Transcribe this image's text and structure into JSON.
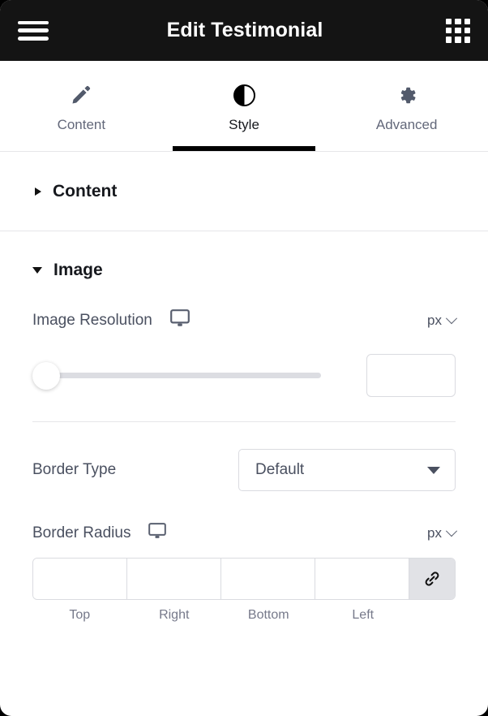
{
  "header": {
    "title": "Edit Testimonial",
    "menu_icon": "hamburger-menu-icon",
    "apps_icon": "grid-apps-icon"
  },
  "tabs": [
    {
      "label": "Content",
      "icon": "pencil-icon",
      "active": false
    },
    {
      "label": "Style",
      "icon": "contrast-icon",
      "active": true
    },
    {
      "label": "Advanced",
      "icon": "gear-icon",
      "active": false
    }
  ],
  "sections": [
    {
      "title": "Content",
      "expanded": false,
      "toggle_icon": "triangle-right-icon"
    },
    {
      "title": "Image",
      "expanded": true,
      "toggle_icon": "triangle-down-icon"
    }
  ],
  "controls": {
    "image_resolution": {
      "label": "Image Resolution",
      "device_icon": "desktop-monitor-icon",
      "unit": "px",
      "unit_chevron": "chevron-down-icon",
      "value": "",
      "placeholder": "",
      "slider_position_percent": 0
    },
    "border_type": {
      "label": "Border Type",
      "selected": "Default",
      "arrow_icon": "caret-down-icon"
    },
    "border_radius": {
      "label": "Border Radius",
      "device_icon": "desktop-monitor-icon",
      "unit": "px",
      "unit_chevron": "chevron-down-icon",
      "fields": [
        {
          "label": "Top",
          "value": ""
        },
        {
          "label": "Right",
          "value": ""
        },
        {
          "label": "Bottom",
          "value": ""
        },
        {
          "label": "Left",
          "value": ""
        }
      ],
      "link_icon": "link-chain-icon",
      "linked": true
    }
  },
  "colors": {
    "header_bg": "#141414",
    "panel_bg": "#ffffff",
    "active_tab_underline": "#000000",
    "label_text": "#4a5060",
    "muted_text": "#76798a",
    "border": "#dadbe0",
    "slider_track": "#dcdde2",
    "link_button_bg": "#e1e2e6"
  }
}
